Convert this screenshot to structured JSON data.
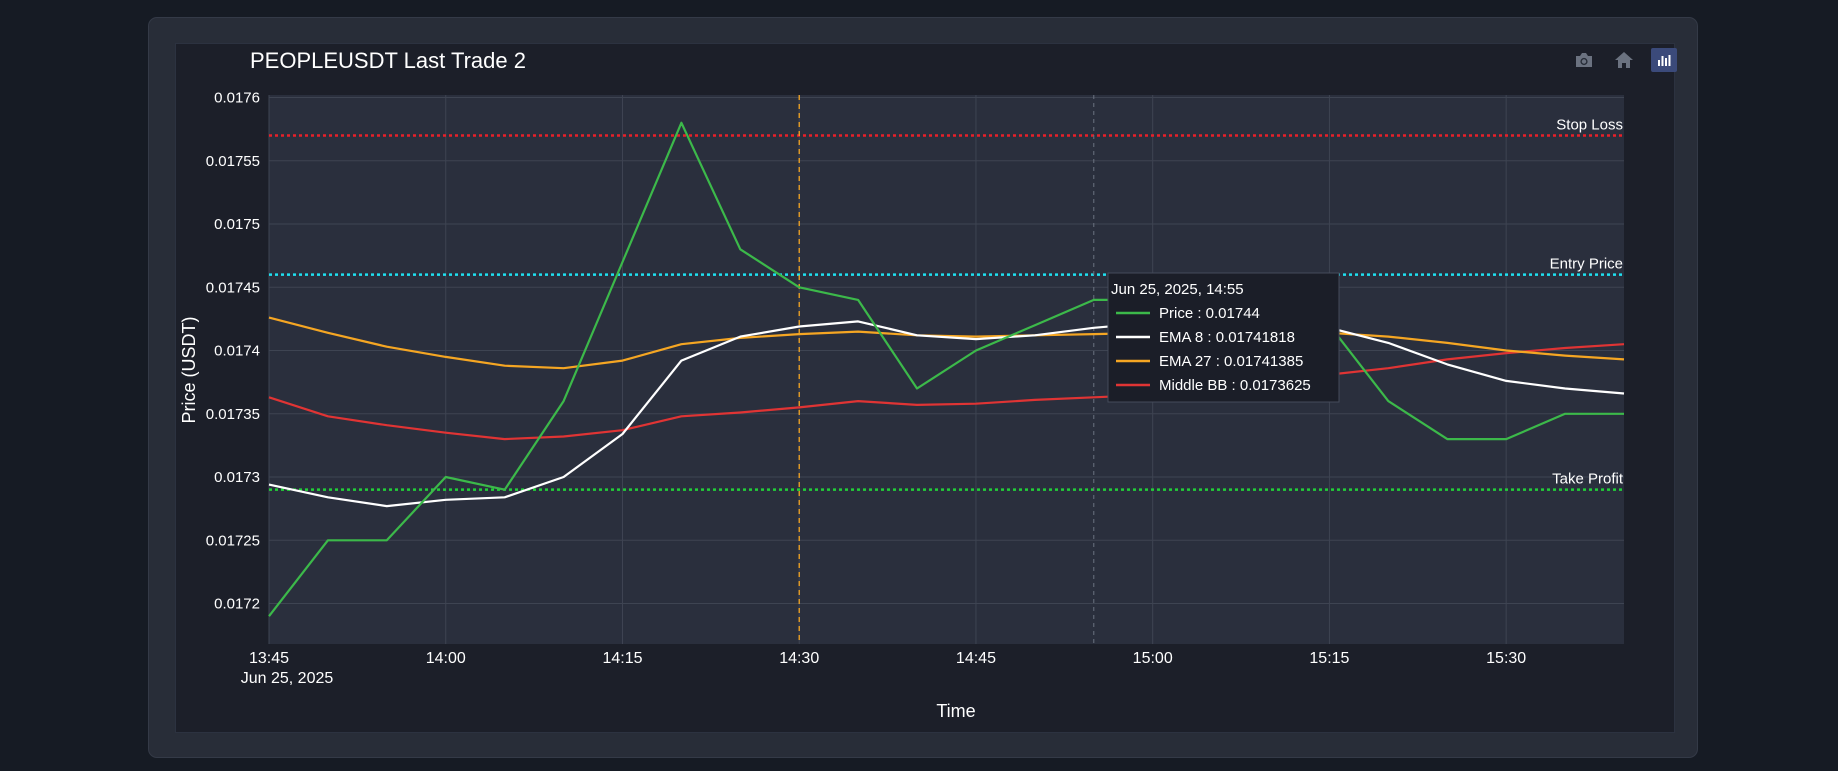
{
  "modebar": {
    "items": [
      {
        "icon": "camera-icon"
      },
      {
        "icon": "home-icon"
      },
      {
        "icon": "plotly-logo-icon"
      }
    ]
  },
  "colors": {
    "price": "#3cb94a",
    "ema8": "#ffffff",
    "ema27": "#f5a623",
    "middle_bb": "#e03434",
    "stop_loss": "#e8202a",
    "entry": "#1fe0f0",
    "take_profit": "#22d038",
    "entry_marker": "#f5a623",
    "plot_bg": "#2a2f3d",
    "grid": "#3e4452"
  },
  "chart_data": {
    "type": "line",
    "title": "PEOPLEUSDT Last Trade 2",
    "xlabel": "Time",
    "ylabel": "Price (USDT)",
    "x_start": "2025-06-25 13:45",
    "x_ticks": [
      "13:45",
      "14:00",
      "14:15",
      "14:30",
      "14:45",
      "15:00",
      "15:15",
      "15:30"
    ],
    "x_tick_sublabel": "Jun 25, 2025",
    "x_range": [
      "13:45",
      "15:40"
    ],
    "ylim": [
      0.017168,
      0.017602
    ],
    "y_ticks": [
      "0.0172",
      "0.01725",
      "0.0173",
      "0.01735",
      "0.0174",
      "0.01745",
      "0.0175",
      "0.01755",
      "0.0176"
    ],
    "y_tick_values": [
      0.0172,
      0.01725,
      0.0173,
      0.01735,
      0.0174,
      0.01745,
      0.0175,
      0.01755,
      0.0176
    ],
    "x": [
      "13:45",
      "13:50",
      "13:55",
      "14:00",
      "14:05",
      "14:10",
      "14:15",
      "14:20",
      "14:25",
      "14:30",
      "14:35",
      "14:40",
      "14:45",
      "14:50",
      "14:55",
      "15:00",
      "15:05",
      "15:10",
      "15:15",
      "15:20",
      "15:25",
      "15:30",
      "15:35",
      "15:40"
    ],
    "series": [
      {
        "name": "Price",
        "key": "price",
        "values": [
          0.01719,
          0.01725,
          0.01725,
          0.0173,
          0.01729,
          0.01736,
          0.01747,
          0.01758,
          0.01748,
          0.01745,
          0.01744,
          0.01737,
          0.0174,
          0.01742,
          0.01744,
          0.01744,
          0.01743,
          0.01743,
          0.01742,
          0.01736,
          0.01733,
          0.01733,
          0.01735,
          0.01735
        ]
      },
      {
        "name": "EMA 8",
        "key": "ema8",
        "values": [
          0.017294,
          0.017284,
          0.017277,
          0.017282,
          0.017284,
          0.0173,
          0.017334,
          0.017392,
          0.017411,
          0.017419,
          0.017423,
          0.017412,
          0.017409,
          0.017412,
          0.017418,
          0.017422,
          0.017423,
          0.017424,
          0.017418,
          0.017406,
          0.017389,
          0.017376,
          0.01737,
          0.017366
        ]
      },
      {
        "name": "EMA 27",
        "key": "ema27",
        "values": [
          0.017426,
          0.017414,
          0.017403,
          0.017395,
          0.017388,
          0.017386,
          0.017392,
          0.017405,
          0.01741,
          0.017413,
          0.017415,
          0.017412,
          0.017411,
          0.017412,
          0.017413,
          0.017414,
          0.017415,
          0.017415,
          0.017414,
          0.017411,
          0.017406,
          0.0174,
          0.017396,
          0.017393
        ]
      },
      {
        "name": "Middle BB",
        "key": "middle_bb",
        "values": [
          0.017363,
          0.017348,
          0.017341,
          0.017335,
          0.01733,
          0.017332,
          0.017337,
          0.017348,
          0.017351,
          0.017355,
          0.01736,
          0.017357,
          0.017358,
          0.017361,
          0.017363,
          0.017365,
          0.017368,
          0.017374,
          0.017381,
          0.017386,
          0.017393,
          0.017398,
          0.017402,
          0.017405
        ]
      }
    ],
    "hlines": [
      {
        "name": "Stop Loss",
        "key": "stop_loss",
        "y": 0.01757
      },
      {
        "name": "Entry Price",
        "key": "entry",
        "y": 0.01746
      },
      {
        "name": "Take Profit",
        "key": "take_profit",
        "y": 0.01729
      }
    ],
    "entry_time": "14:30",
    "tooltip": {
      "x": "14:55",
      "header": "Jun 25, 2025, 14:55",
      "rows": [
        {
          "key": "price",
          "text": "Price : 0.01744"
        },
        {
          "key": "ema8",
          "text": "EMA 8 : 0.01741818"
        },
        {
          "key": "ema27",
          "text": "EMA 27 : 0.01741385"
        },
        {
          "key": "middle_bb",
          "text": "Middle BB : 0.0173625"
        }
      ]
    },
    "grid": true
  }
}
